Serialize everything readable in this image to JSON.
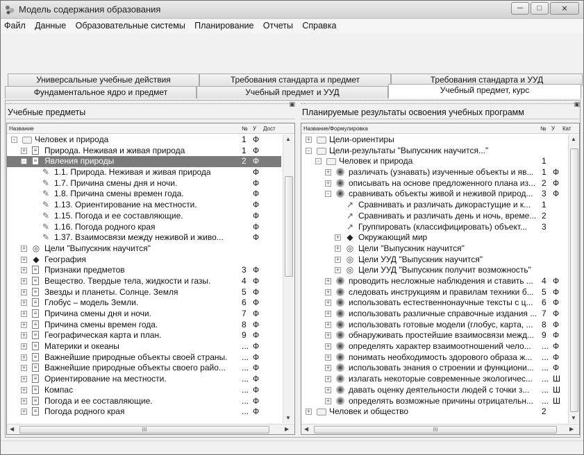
{
  "window": {
    "title": "Модель содержания образования"
  },
  "menu": [
    "Файл",
    "Данные",
    "Образовательные системы",
    "Планирование",
    "Отчеты",
    "Справка"
  ],
  "tabs_row1": [
    "Универсальные учебные действия",
    "Требования стандарта и предмет",
    "Требования стандарта и УУД"
  ],
  "tabs_row2": [
    "Фундаментальное ядро и предмет",
    "Учебный предмет и УУД",
    "Учебный предмет, курс"
  ],
  "left": {
    "title": "Учебные предметы",
    "headers": {
      "name": "Название",
      "num": "№",
      "u": "У",
      "dost": "Дост"
    },
    "rows": [
      {
        "label": "Человек и природа",
        "num": "1",
        "flag": "Ф"
      },
      {
        "label": "Природа. Неживая и живая природа",
        "num": "1",
        "flag": "Ф"
      },
      {
        "label": "Явления природы",
        "num": "2",
        "flag": "Ф"
      },
      {
        "label": "1.1. Природа. Неживая и живая природа",
        "num": "",
        "flag": "Ф"
      },
      {
        "label": "1.7. Причина смены дня и ночи.",
        "num": "",
        "flag": "Ф"
      },
      {
        "label": "1.8. Причина смены времен года.",
        "num": "",
        "flag": "Ф"
      },
      {
        "label": "1.13. Ориентирование на местности.",
        "num": "",
        "flag": "Ф"
      },
      {
        "label": "1.15. Погода и ее составляющие.",
        "num": "",
        "flag": "Ф"
      },
      {
        "label": "1.16. Погода родного края",
        "num": "",
        "flag": "Ф"
      },
      {
        "label": "1.37. Взаимосвязи между неживой и живо...",
        "num": "",
        "flag": "Ф"
      },
      {
        "label": "Цели \"Выпускник научится\"",
        "num": "",
        "flag": ""
      },
      {
        "label": "География",
        "num": "",
        "flag": ""
      },
      {
        "label": "Признаки предметов",
        "num": "3",
        "flag": "Ф"
      },
      {
        "label": "Вещество. Твердые тела, жидкости и газы.",
        "num": "4",
        "flag": "Ф"
      },
      {
        "label": "Звезды и планеты. Солнце. Земля",
        "num": "5",
        "flag": "Ф"
      },
      {
        "label": "Глобус – модель Земли.",
        "num": "6",
        "flag": "Ф"
      },
      {
        "label": "Причина смены дня и ночи.",
        "num": "7",
        "flag": "Ф"
      },
      {
        "label": "Причина смены времен года.",
        "num": "8",
        "flag": "Ф"
      },
      {
        "label": "Географическая карта и план.",
        "num": "9",
        "flag": "Ф"
      },
      {
        "label": "Материки и океаны",
        "num": "...",
        "flag": "Ф"
      },
      {
        "label": "Важнейшие природные объекты своей страны.",
        "num": "...",
        "flag": "Ф"
      },
      {
        "label": "Важнейшие природные объекты своего райо...",
        "num": "...",
        "flag": "Ф"
      },
      {
        "label": "Ориентирование на местности.",
        "num": "...",
        "flag": "Ф"
      },
      {
        "label": "Компас",
        "num": "...",
        "flag": "Ф"
      },
      {
        "label": "Погода и ее составляющие.",
        "num": "...",
        "flag": "Ф"
      },
      {
        "label": "Погода родного края",
        "num": "...",
        "flag": "Ф"
      }
    ],
    "hscroll_label": "III"
  },
  "right": {
    "title": "Планируемые результаты освоения учебных программ",
    "headers": {
      "name": "Название/Формулировка",
      "num": "№",
      "u": "У",
      "kat": "Кат"
    },
    "rows": [
      {
        "label": "Цели-ориентиры",
        "num": "",
        "flag": ""
      },
      {
        "label": "Цели-результаты \"Выпускник научится...\"",
        "num": "",
        "flag": ""
      },
      {
        "label": "Человек и природа",
        "num": "1",
        "flag": ""
      },
      {
        "label": "различать (узнавать) изученные объекты и яв...",
        "num": "1",
        "flag": "Ф"
      },
      {
        "label": "описывать на основе предложенного плана из...",
        "num": "2",
        "flag": "Ф"
      },
      {
        "label": "сравнивать объекты живой и неживой природ...",
        "num": "3",
        "flag": "Ф"
      },
      {
        "label": "Сравнивать и различать дикорастущие и к...",
        "num": "1",
        "flag": ""
      },
      {
        "label": "Сравнивать и различать день и ночь, време...",
        "num": "2",
        "flag": ""
      },
      {
        "label": "Группировать (классифицировать) объект...",
        "num": "3",
        "flag": ""
      },
      {
        "label": "Окружающий мир",
        "num": "",
        "flag": ""
      },
      {
        "label": "Цели \"Выпускник научится\"",
        "num": "",
        "flag": ""
      },
      {
        "label": "Цели УУД \"Выпускник научится\"",
        "num": "",
        "flag": ""
      },
      {
        "label": "Цели УУД \"Выпускник получит возможность\"",
        "num": "",
        "flag": ""
      },
      {
        "label": "проводить несложные наблюдения и ставить ...",
        "num": "4",
        "flag": "Ф"
      },
      {
        "label": "следовать инструкциям и правилам техники б...",
        "num": "5",
        "flag": "Ф"
      },
      {
        "label": "использовать естественнонаучные тексты с ц...",
        "num": "6",
        "flag": "Ф"
      },
      {
        "label": "использовать различные справочные издания ...",
        "num": "7",
        "flag": "Ф"
      },
      {
        "label": "использовать готовые модели (глобус, карта, ...",
        "num": "8",
        "flag": "Ф"
      },
      {
        "label": "обнаруживать простейшие взаимосвязи межд...",
        "num": "9",
        "flag": "Ф"
      },
      {
        "label": "определять характер взаимоотношений чело...",
        "num": "...",
        "flag": "Ф"
      },
      {
        "label": "понимать необходимость здорового образа ж...",
        "num": "...",
        "flag": "Ф"
      },
      {
        "label": "использовать знания о строении и функциони...",
        "num": "...",
        "flag": "Ф"
      },
      {
        "label": "излагать некоторые современные экологичес...",
        "num": "...",
        "flag": "Ш"
      },
      {
        "label": "давать оценку деятельности людей с точки з...",
        "num": "...",
        "flag": "Ш"
      },
      {
        "label": "определять возможные причины отрицательн...",
        "num": "...",
        "flag": "Ш"
      },
      {
        "label": "Человек и общество",
        "num": "2",
        "flag": ""
      }
    ],
    "hscroll_label": "III"
  }
}
